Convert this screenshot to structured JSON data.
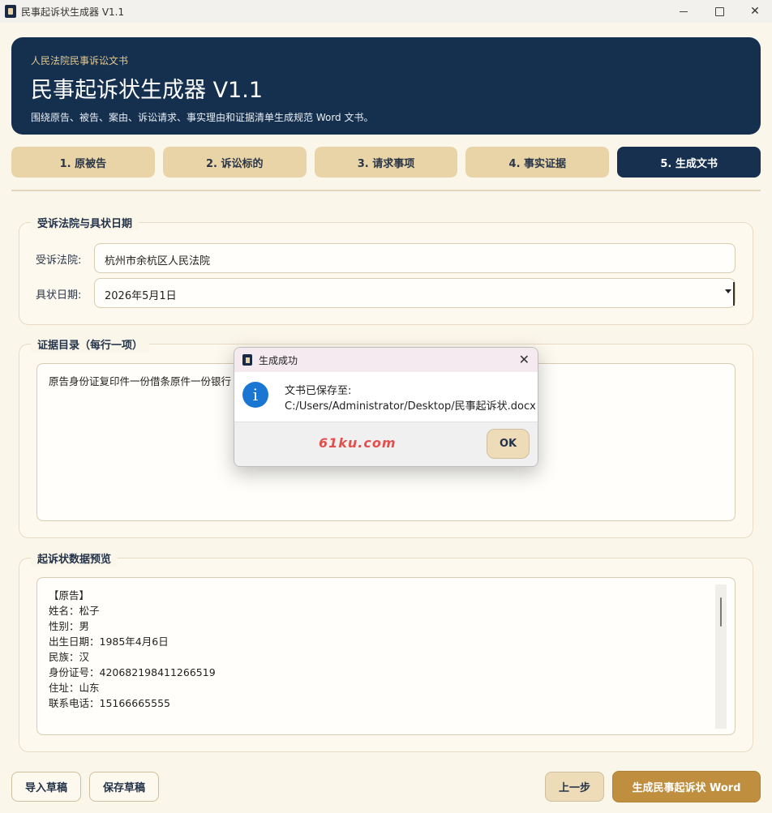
{
  "window": {
    "title": "民事起诉状生成器 V1.1"
  },
  "header": {
    "subtitle": "人民法院民事诉讼文书",
    "title": "民事起诉状生成器 V1.1",
    "description": "围绕原告、被告、案由、诉讼请求、事实理由和证据清单生成规范 Word 文书。"
  },
  "tabs": [
    {
      "label": "1. 原被告",
      "active": false
    },
    {
      "label": "2. 诉讼标的",
      "active": false
    },
    {
      "label": "3. 请求事项",
      "active": false
    },
    {
      "label": "4. 事实证据",
      "active": false
    },
    {
      "label": "5. 生成文书",
      "active": true
    }
  ],
  "court_group": {
    "title": "受诉法院与具状日期",
    "court_label": "受诉法院:",
    "court_value": "杭州市余杭区人民法院",
    "date_label": "具状日期:",
    "date_value": "2026年5月1日"
  },
  "evidence_group": {
    "title": "证据目录（每行一项）",
    "text": "原告身份证复印件一份借条原件一份银行"
  },
  "preview_group": {
    "title": "起诉状数据预览",
    "lines": [
      "【原告】",
      "姓名：松子",
      "性别：男",
      "出生日期：1985年4月6日",
      "民族：汉",
      "身份证号：420682198411266519",
      "住址：山东",
      "联系电话：15166665555"
    ]
  },
  "buttons": {
    "import": "导入草稿",
    "save": "保存草稿",
    "prev": "上一步",
    "generate": "生成民事起诉状 Word"
  },
  "dialog": {
    "title": "生成成功",
    "message_line1": "文书已保存至:",
    "message_line2": "C:/Users/Administrator/Desktop/民事起诉状.docx",
    "ok": "OK",
    "watermark": "61ku.com"
  }
}
